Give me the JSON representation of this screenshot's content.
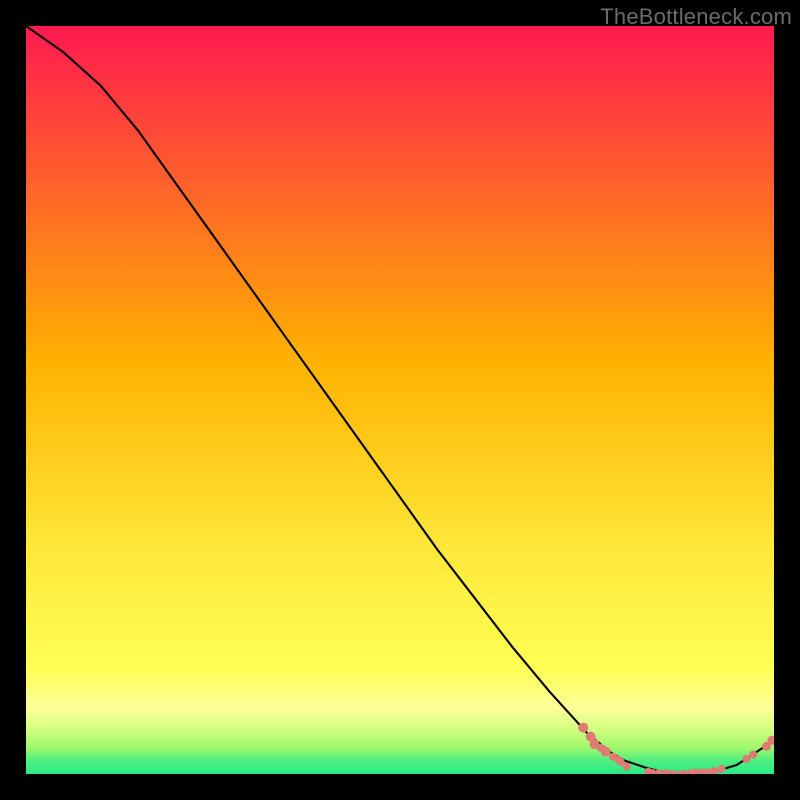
{
  "watermark": "TheBottleneck.com",
  "colors": {
    "black": "#000000",
    "curve": "#000000",
    "dots": "#e07b74",
    "grad_top": "#ff1a50",
    "grad_mid": "#ffd400",
    "grad_yellow": "#ffff55",
    "grad_yellowLight": "#ffff9a",
    "grad_lime": "#d4ff7f",
    "grad_yellowgreen": "#9ff76d",
    "grad_green": "#28e98a"
  },
  "chart_data": {
    "type": "line",
    "title": "",
    "xlabel": "",
    "ylabel": "",
    "x": [
      0.0,
      0.05,
      0.1,
      0.15,
      0.2,
      0.25,
      0.3,
      0.35,
      0.4,
      0.45,
      0.5,
      0.55,
      0.6,
      0.65,
      0.7,
      0.75,
      0.78,
      0.8,
      0.83,
      0.85,
      0.88,
      0.9,
      0.92,
      0.95,
      0.97,
      1.0
    ],
    "y": [
      1.0,
      0.965,
      0.92,
      0.86,
      0.79,
      0.72,
      0.65,
      0.58,
      0.51,
      0.44,
      0.37,
      0.3,
      0.235,
      0.17,
      0.11,
      0.055,
      0.03,
      0.018,
      0.008,
      0.003,
      0.0,
      0.0,
      0.003,
      0.012,
      0.025,
      0.045
    ],
    "xlim": [
      0,
      1
    ],
    "ylim": [
      0,
      1
    ],
    "markers": [
      {
        "x": 0.745,
        "y": 0.062,
        "r": 5
      },
      {
        "x": 0.755,
        "y": 0.05,
        "r": 5
      },
      {
        "x": 0.76,
        "y": 0.04,
        "r": 5
      },
      {
        "x": 0.768,
        "y": 0.035,
        "r": 4
      },
      {
        "x": 0.775,
        "y": 0.03,
        "r": 5
      },
      {
        "x": 0.785,
        "y": 0.023,
        "r": 4
      },
      {
        "x": 0.792,
        "y": 0.019,
        "r": 4
      },
      {
        "x": 0.795,
        "y": 0.016,
        "r": 4
      },
      {
        "x": 0.803,
        "y": 0.01,
        "r": 4
      },
      {
        "x": 0.832,
        "y": 0.003,
        "r": 4
      },
      {
        "x": 0.838,
        "y": 0.002,
        "r": 3.5
      },
      {
        "x": 0.846,
        "y": 0.001,
        "r": 4
      },
      {
        "x": 0.855,
        "y": 0.001,
        "r": 4
      },
      {
        "x": 0.863,
        "y": 0.0,
        "r": 4
      },
      {
        "x": 0.87,
        "y": 0.0,
        "r": 3.5
      },
      {
        "x": 0.879,
        "y": 0.0,
        "r": 4
      },
      {
        "x": 0.888,
        "y": 0.001,
        "r": 4
      },
      {
        "x": 0.895,
        "y": 0.002,
        "r": 4
      },
      {
        "x": 0.904,
        "y": 0.002,
        "r": 4
      },
      {
        "x": 0.912,
        "y": 0.003,
        "r": 3.5
      },
      {
        "x": 0.92,
        "y": 0.004,
        "r": 4
      },
      {
        "x": 0.93,
        "y": 0.007,
        "r": 4
      },
      {
        "x": 0.963,
        "y": 0.02,
        "r": 4
      },
      {
        "x": 0.972,
        "y": 0.026,
        "r": 4
      },
      {
        "x": 0.99,
        "y": 0.037,
        "r": 4.5
      },
      {
        "x": 0.997,
        "y": 0.045,
        "r": 4.5
      }
    ]
  }
}
